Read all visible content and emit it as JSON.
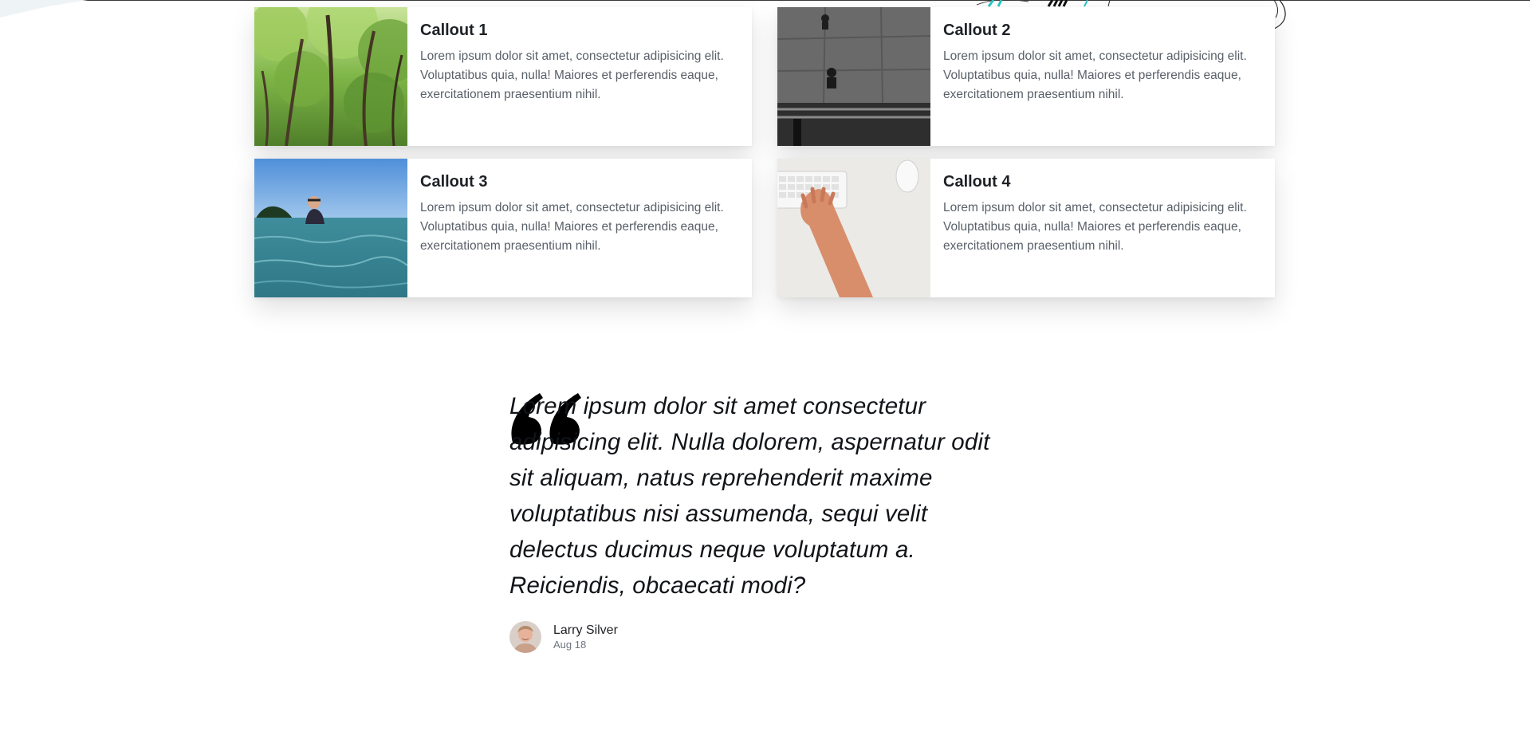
{
  "callouts": [
    {
      "title": "Callout 1",
      "text": "Lorem ipsum dolor sit amet, consectetur adipisicing elit. Voluptatibus quia, nulla! Maiores et perferendis eaque, exercitationem praesentium nihil.",
      "image": "forest-trees"
    },
    {
      "title": "Callout 2",
      "text": "Lorem ipsum dolor sit amet, consectetur adipisicing elit. Voluptatibus quia, nulla! Maiores et perferendis eaque, exercitationem praesentium nihil.",
      "image": "aerial-skateboarder-grayscale"
    },
    {
      "title": "Callout 3",
      "text": "Lorem ipsum dolor sit amet, consectetur adipisicing elit. Voluptatibus quia, nulla! Maiores et perferendis eaque, exercitationem praesentium nihil.",
      "image": "person-swimming-in-sea"
    },
    {
      "title": "Callout 4",
      "text": "Lorem ipsum dolor sit amet, consectetur adipisicing elit. Voluptatibus quia, nulla! Maiores et perferendis eaque, exercitationem praesentium nihil.",
      "image": "hand-on-keyboard"
    }
  ],
  "testimonial": {
    "quote": "Lorem ipsum dolor sit amet consectetur adipisicing elit. Nulla dolorem, aspernatur odit sit aliquam, natus reprehenderit maxime voluptatibus nisi assumenda, sequi velit delectus ducimus neque voluptatum a. Reiciendis, obcaecati modi?",
    "quote_icon": "quote-mark-icon",
    "author_name": "Larry Silver",
    "date": "Aug 18"
  },
  "colors": {
    "text": "#1e2125",
    "muted": "#5a6069",
    "accent_teal": "#2cc6c6"
  }
}
